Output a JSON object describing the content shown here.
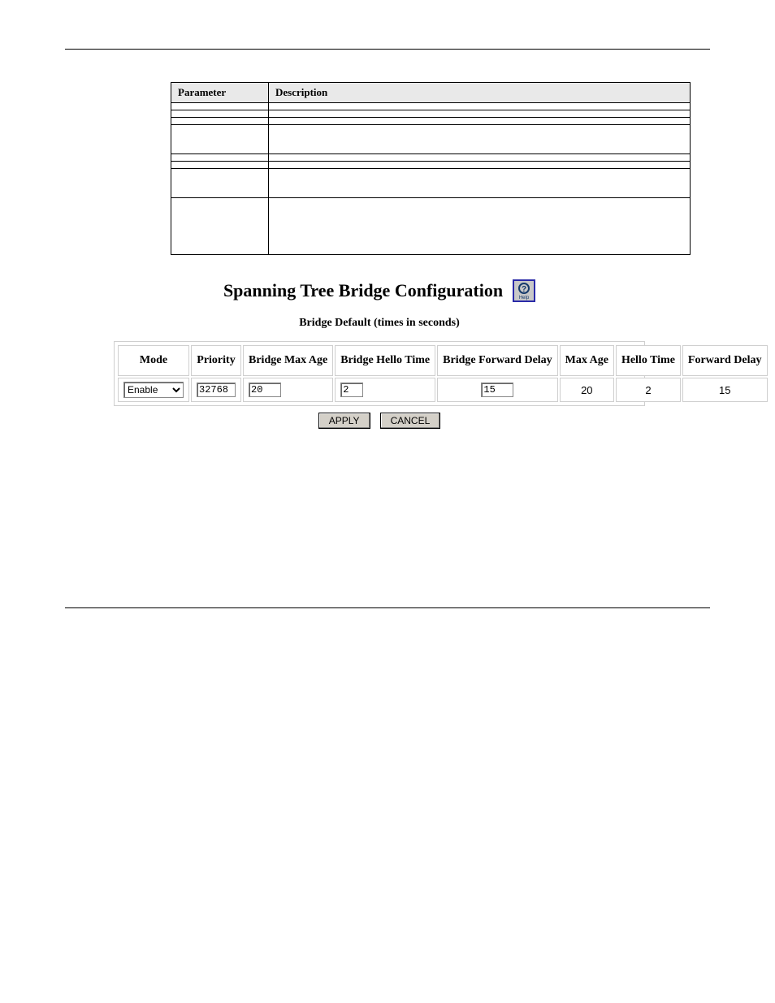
{
  "param_table": {
    "headers": {
      "param": "Parameter",
      "desc": "Description"
    },
    "rows": [
      {
        "param": "",
        "desc": ""
      },
      {
        "param": "",
        "desc": ""
      },
      {
        "param": "",
        "desc": ""
      },
      {
        "param": "",
        "desc": "",
        "two_line": true
      },
      {
        "param": "",
        "desc": ""
      },
      {
        "param": "",
        "desc": ""
      },
      {
        "param": "",
        "desc": "",
        "two_line": true
      },
      {
        "param": "",
        "desc": "",
        "tall": true
      }
    ]
  },
  "body": {
    "p1": "",
    "heading": "",
    "p2": ""
  },
  "ui": {
    "title": "Spanning Tree Bridge Configuration",
    "help_label": "Help",
    "subtitle": "Bridge Default (times in seconds)",
    "headers": {
      "mode": "Mode",
      "priority": "Priority",
      "bridge_max_age": "Bridge Max Age",
      "bridge_hello_time": "Bridge Hello Time",
      "bridge_forward_delay": "Bridge Forward Delay",
      "max_age": "Max Age",
      "hello_time": "Hello Time",
      "forward_delay": "Forward Delay"
    },
    "values": {
      "mode": "Enable",
      "priority": "32768",
      "bridge_max_age": "20",
      "bridge_hello_time": "2",
      "bridge_forward_delay": "15",
      "max_age": "20",
      "hello_time": "2",
      "forward_delay": "15"
    },
    "buttons": {
      "apply": "APPLY",
      "cancel": "CANCEL"
    }
  }
}
